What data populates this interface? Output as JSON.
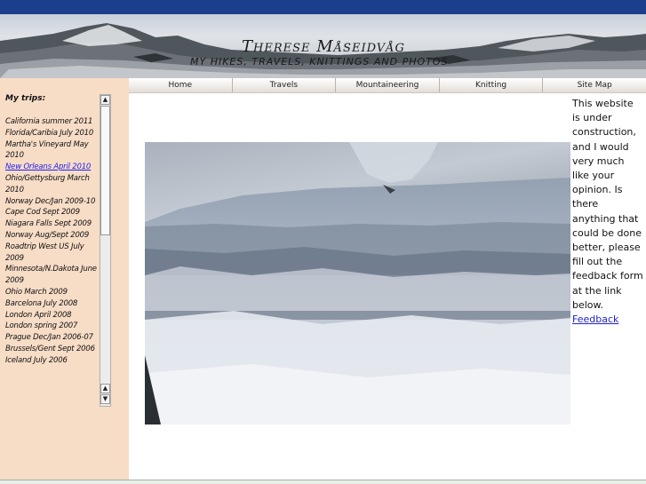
{
  "header": {
    "title": "Therese Måseidvåg",
    "subtitle": "MY HIKES, TRAVELS, KNITTINGS AND PHOTOS"
  },
  "nav": {
    "items": [
      {
        "label": "Home"
      },
      {
        "label": "Travels"
      },
      {
        "label": "Mountaineering"
      },
      {
        "label": "Knitting"
      },
      {
        "label": "Site Map"
      }
    ]
  },
  "sidebar": {
    "heading": "My trips:",
    "trips": [
      {
        "label": "California summer 2011"
      },
      {
        "label": "Florida/Caribia July 2010"
      },
      {
        "label": "Martha's Vineyard May 2010"
      },
      {
        "label": "New Orleans April 2010"
      },
      {
        "label": "Ohio/Gettysburg March 2010"
      },
      {
        "label": "Norway Dec/Jan 2009-10"
      },
      {
        "label": "Cape Cod Sept 2009"
      },
      {
        "label": "Niagara Falls Sept 2009"
      },
      {
        "label": "Norway Aug/Sept 2009"
      },
      {
        "label": "Roadtrip West US July 2009"
      },
      {
        "label": "Minnesota/N.Dakota June 2009"
      },
      {
        "label": "Ohio March 2009"
      },
      {
        "label": "Barcelona July 2008"
      },
      {
        "label": "London April 2008"
      },
      {
        "label": "London spring 2007"
      },
      {
        "label": "Prague Dec/Jan 2006-07"
      },
      {
        "label": "Brussels/Gent Sept 2006"
      },
      {
        "label": "Iceland July 2006"
      }
    ],
    "active_trip": "New Orleans April 2010"
  },
  "main": {
    "note": "This website is under construction, and I would very much like your opinion. Is there anything that could be done better, please fill out the feedback form at the link below.",
    "feedback_link": "Feedback"
  },
  "colors": {
    "topbar": "#1b3f8c",
    "sidebar_bg": "#f7dcc6",
    "link": "#2222ee"
  },
  "icons": {
    "scroll_up": "up-arrow-icon",
    "scroll_down": "down-arrow-icon"
  }
}
